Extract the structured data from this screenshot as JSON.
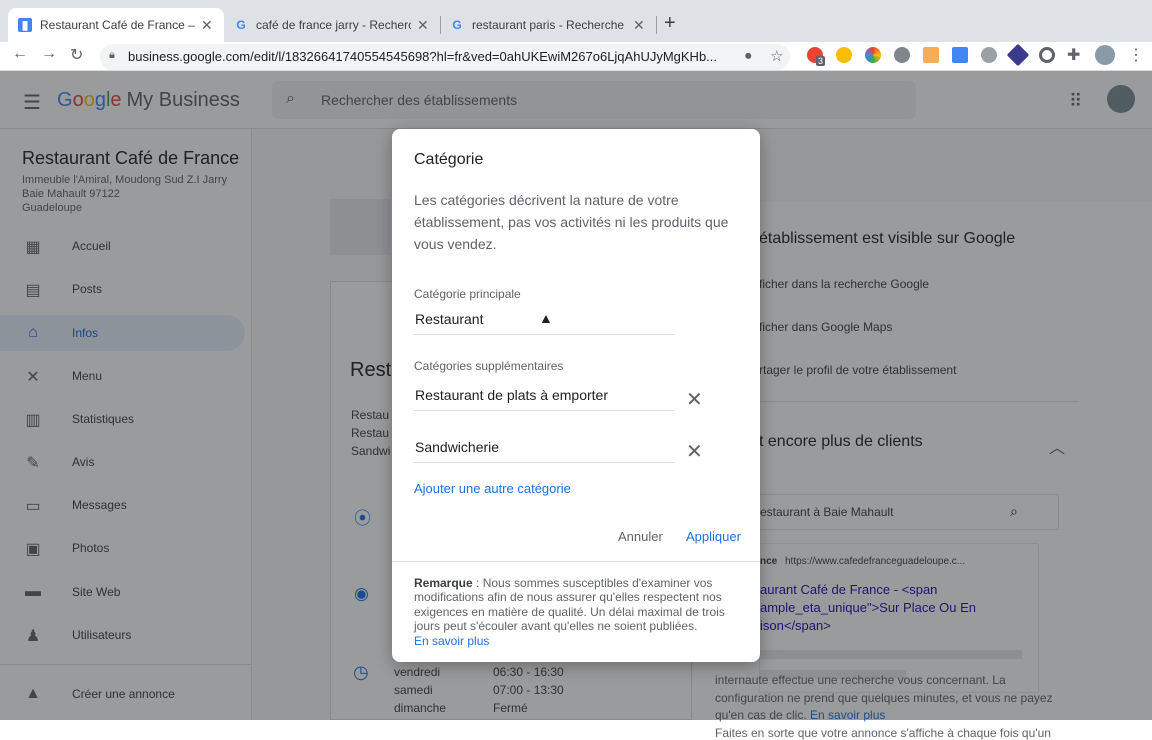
{
  "browser": {
    "tabs": [
      {
        "title": "Restaurant Café de France – In",
        "favicon": "G"
      },
      {
        "title": "café de france jarry - Recherch",
        "favicon": "G"
      },
      {
        "title": "restaurant paris - Recherche G",
        "favicon": "G"
      }
    ],
    "close_glyph": "✕",
    "newtab_glyph": "+",
    "url": "business.google.com/edit/l/18326641740554545698?hl=fr&ved=0ahUKEwiM267o6LjqAhUJyMgKHb...",
    "ext_badge": "3"
  },
  "header": {
    "logo": [
      "G",
      "o",
      "o",
      "g",
      "l",
      "e"
    ],
    "product": "My Business",
    "search_placeholder": "Rechercher des établissements"
  },
  "sidebar": {
    "business_name": "Restaurant Café de France",
    "address_lines": [
      "Immeuble l'Amiral, Moudong Sud Z.I Jarry",
      "Baie Mahault 97122",
      "Guadeloupe"
    ],
    "items": [
      {
        "label": "Accueil",
        "icon": "dashboard-icon",
        "glyph": "▦"
      },
      {
        "label": "Posts",
        "icon": "posts-icon",
        "glyph": "▤"
      },
      {
        "label": "Infos",
        "icon": "store-icon",
        "glyph": "⌂"
      },
      {
        "label": "Menu",
        "icon": "utensils-icon",
        "glyph": "✕"
      },
      {
        "label": "Statistiques",
        "icon": "bar-chart-icon",
        "glyph": "▥"
      },
      {
        "label": "Avis",
        "icon": "reviews-icon",
        "glyph": "✎"
      },
      {
        "label": "Messages",
        "icon": "messages-icon",
        "glyph": "▭"
      },
      {
        "label": "Photos",
        "icon": "photos-icon",
        "glyph": "▣"
      },
      {
        "label": "Site Web",
        "icon": "website-icon",
        "glyph": "▬"
      },
      {
        "label": "Utilisateurs",
        "icon": "add-user-icon",
        "glyph": "♟"
      }
    ],
    "ads_label": "Créer une annonce",
    "ads_glyph": "▲"
  },
  "background": {
    "left_title": "Rest",
    "left_lines": [
      "Restau",
      "Restau",
      "Sandwi"
    ],
    "hours": [
      {
        "day": "vendredi",
        "time": "06:30 - 16:30"
      },
      {
        "day": "samedi",
        "time": "07:00 - 13:30"
      },
      {
        "day": "dimanche",
        "time": "Fermé"
      }
    ],
    "visible_title": "établissement est visible sur Google",
    "visible_items": [
      "ficher dans la recherche Google",
      "ficher dans Google Maps",
      "rtager le profil de votre établissement"
    ],
    "clients_title": "t encore plus de clients",
    "preview_search": "estaurant à Baie Mahault",
    "ad_source": "nce",
    "ad_url": "https://www.cafedefranceguadeloupe.c...",
    "ad_title_lines": [
      "aurant Café de France - <span",
      "ample_eta_unique\">Sur Place Ou En",
      "ison</span>"
    ],
    "footer_lines": [
      "Faites en sorte que votre annonce s'affiche à chaque fois qu'un",
      "internaute effectue une recherche vous concernant. La",
      "configuration ne prend que quelques minutes, et vous ne payez"
    ],
    "footer_last": "qu'en cas de clic.",
    "footer_link": "En savoir plus"
  },
  "dialog": {
    "title": "Catégorie",
    "description": "Les catégories décrivent la nature de votre établissement, pas vos activités ni les produits que vous vendez.",
    "primary_label": "Catégorie principale",
    "primary_value": "Restaurant",
    "additional_label": "Catégories supplémentaires",
    "additional": [
      "Restaurant de plats à emporter",
      "Sandwicherie"
    ],
    "clear_glyph": "✕",
    "add_link": "Ajouter une autre catégorie",
    "cancel": "Annuler",
    "apply": "Appliquer",
    "note_bold": "Remarque",
    "note_text": " : Nous sommes susceptibles d'examiner vos modifications afin de nous assurer qu'elles respectent nos exigences en matière de qualité. Un délai maximal de trois jours peut s'écouler avant qu'elles ne soient publiées.",
    "note_link": "En savoir plus"
  }
}
